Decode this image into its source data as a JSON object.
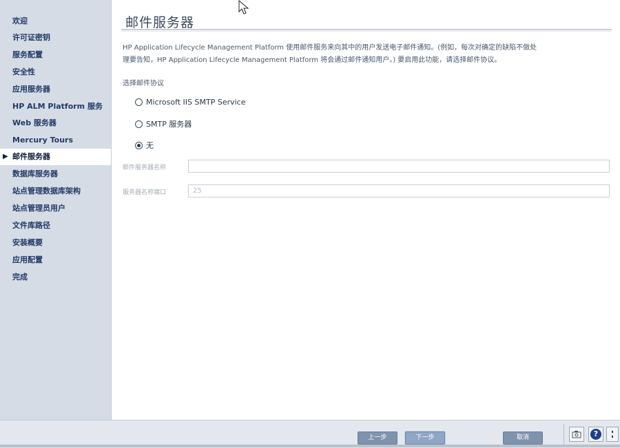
{
  "sidebar": {
    "items": [
      {
        "label": "欢迎"
      },
      {
        "label": "许可证密钥"
      },
      {
        "label": "服务配置"
      },
      {
        "label": "安全性"
      },
      {
        "label": "应用服务器"
      },
      {
        "label": "HP ALM Platform 服务"
      },
      {
        "label": "Web 服务器"
      },
      {
        "label": "Mercury Tours"
      },
      {
        "label": "邮件服务器",
        "active": true
      },
      {
        "label": "数据库服务器"
      },
      {
        "label": "站点管理数据库架构"
      },
      {
        "label": "站点管理员用户"
      },
      {
        "label": "文件库路径"
      },
      {
        "label": "安装概要"
      },
      {
        "label": "应用配置"
      },
      {
        "label": "完成"
      }
    ],
    "active_marker": "▶"
  },
  "main": {
    "title": "邮件服务器",
    "description_line1": "HP Application Lifecycle Management Platform 使用邮件服务来向其中的用户发送电子邮件通知。(例如，每次对确定的缺陷不做处",
    "description_line2": "理要告知，HP Application Lifecycle Management Platform 将会通过邮件通知用户。) 要启用此功能，请选择邮件协议。",
    "protocol_label": "选择邮件协议",
    "options": [
      {
        "label": "Microsoft IIS SMTP Service",
        "selected": false
      },
      {
        "label": "SMTP 服务器",
        "selected": false
      },
      {
        "label": "无",
        "selected": true
      }
    ],
    "server_name_label": "邮件服务器名称",
    "server_name_value": "",
    "server_port_label": "服务器名称端口",
    "server_port_value": "25"
  },
  "footer": {
    "back_label": "上一步",
    "next_label": "下一步",
    "cancel_label": "取消"
  },
  "icons": {
    "toolbar": [
      "camera-icon",
      "help-icon",
      "more-icon"
    ],
    "cursor": "mouse-pointer-icon"
  },
  "colors": {
    "sidebar_bg": "#d6dce6",
    "nav_text": "#223a66",
    "button": "#7f93ad"
  }
}
